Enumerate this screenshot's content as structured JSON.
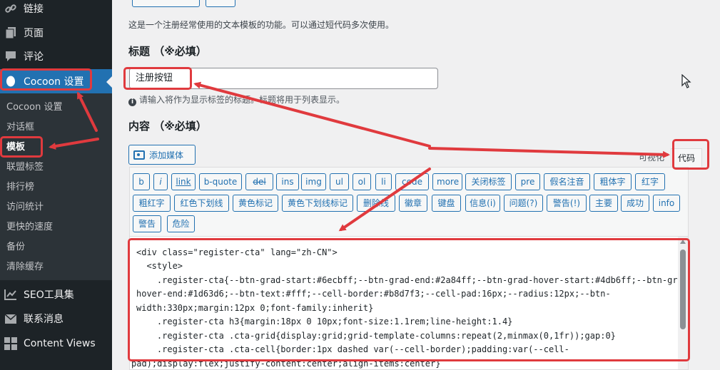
{
  "sidebar": {
    "top_items": [
      {
        "label": "链接",
        "icon": "link-icon"
      },
      {
        "label": "页面",
        "icon": "pages-icon"
      },
      {
        "label": "评论",
        "icon": "comments-icon"
      },
      {
        "label": "Cocoon 设置",
        "icon": "cocoon-icon"
      }
    ],
    "submenu": [
      {
        "label": "Cocoon 设置"
      },
      {
        "label": "对话框"
      },
      {
        "label": "模板"
      },
      {
        "label": "联盟标签"
      },
      {
        "label": "排行榜"
      },
      {
        "label": "访问统计"
      },
      {
        "label": "更快的速度"
      },
      {
        "label": "备份"
      },
      {
        "label": "清除缓存"
      }
    ],
    "bottom_items": [
      {
        "label": "SEO工具集",
        "icon": "seo-chart-icon"
      },
      {
        "label": "联系消息",
        "icon": "mail-icon"
      },
      {
        "label": "Content Views",
        "icon": "grid-icon"
      }
    ]
  },
  "main": {
    "description": "这是一个注册经常使用的文本模板的功能。可以通过短代码多次使用。",
    "title_label": "标题 （※必填）",
    "title_value": "注册按钮",
    "title_hint": "请输入将作为显示标签的标题。标题将用于列表显示。",
    "content_label": "内容 （※必填）",
    "add_media_label": "添加媒体",
    "tabs": {
      "visual": "可视化",
      "code": "代码"
    },
    "quicktags_row1": [
      "b",
      "i",
      "link",
      "b-quote",
      "del",
      "ins",
      "img",
      "ul",
      "ol",
      "li",
      "code",
      "more",
      "关闭标签",
      "pre",
      "假名注音",
      "粗体字",
      "红字"
    ],
    "quicktags_row2": [
      "粗红字",
      "红色下划线",
      "黄色标记",
      "黄色下划线标记",
      "删除线",
      "徽章",
      "键盘",
      "信息(i)",
      "问题(?)",
      "警告(!)",
      "主要",
      "成功",
      "info"
    ],
    "quicktags_row3": [
      "警告",
      "危险"
    ],
    "code_lines": [
      "<div class=\"register-cta\" lang=\"zh-CN\">",
      "  <style>",
      "    .register-cta{--btn-grad-start:#6ecbff;--btn-grad-end:#2a84ff;--btn-grad-hover-start:#4db6ff;--btn-grad-",
      "hover-end:#1d63d6;--btn-text:#fff;--cell-border:#b8d7f3;--cell-pad:16px;--radius:12px;--btn-",
      "width:330px;margin:12px 0;font-family:inherit}",
      "    .register-cta h3{margin:18px 0 10px;font-size:1.1rem;line-height:1.4}",
      "    .register-cta .cta-grid{display:grid;grid-template-columns:repeat(2,minmax(0,1fr));gap:0}",
      "    .register-cta .cta-cell{border:1px dashed var(--cell-border);padding:var(--cell-",
      "pad);display:flex;justify-content:center;align-items:center}"
    ]
  },
  "colors": {
    "sidebar_bg": "#1d2327",
    "accent": "#2271b1",
    "annotation": "#e03a3e"
  }
}
